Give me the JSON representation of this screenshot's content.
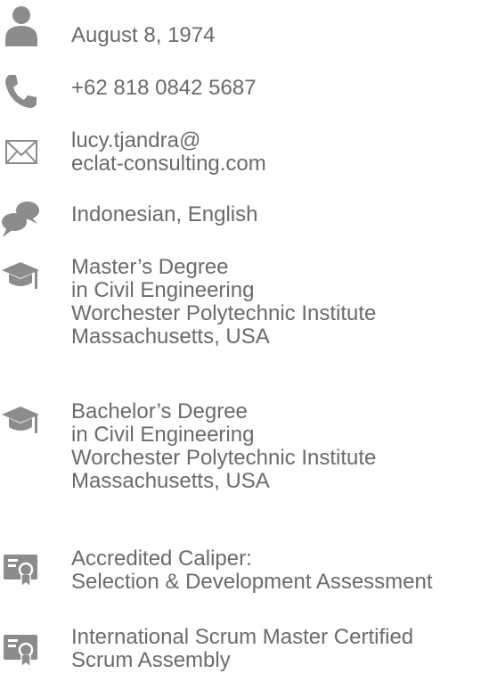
{
  "profile": {
    "birthdate": "August 8, 1974",
    "phone": "+62 818 0842 5687",
    "email_line1": "lucy.tjandra@",
    "email_line2": "eclat-consulting.com",
    "languages": "Indonesian, English",
    "education": [
      {
        "degree": "Master’s Degree",
        "field": "in Civil Engineering",
        "school": "Worchester Polytechnic Institute",
        "location": "Massachusetts, USA"
      },
      {
        "degree": "Bachelor’s Degree",
        "field": "in Civil Engineering",
        "school": "Worchester Polytechnic Institute",
        "location": "Massachusetts, USA"
      }
    ],
    "certifications": [
      {
        "line1": "Accredited Caliper:",
        "line2": "Selection & Development Assessment"
      },
      {
        "line1": "International Scrum Master Certified",
        "line2": "Scrum Assembly"
      }
    ]
  },
  "icons": {
    "color": "#8c8c8c",
    "birthdate": "person-icon",
    "phone": "phone-icon",
    "email": "envelope-icon",
    "languages": "speech-bubbles-icon",
    "education": "graduation-cap-icon",
    "certification": "certificate-icon"
  }
}
